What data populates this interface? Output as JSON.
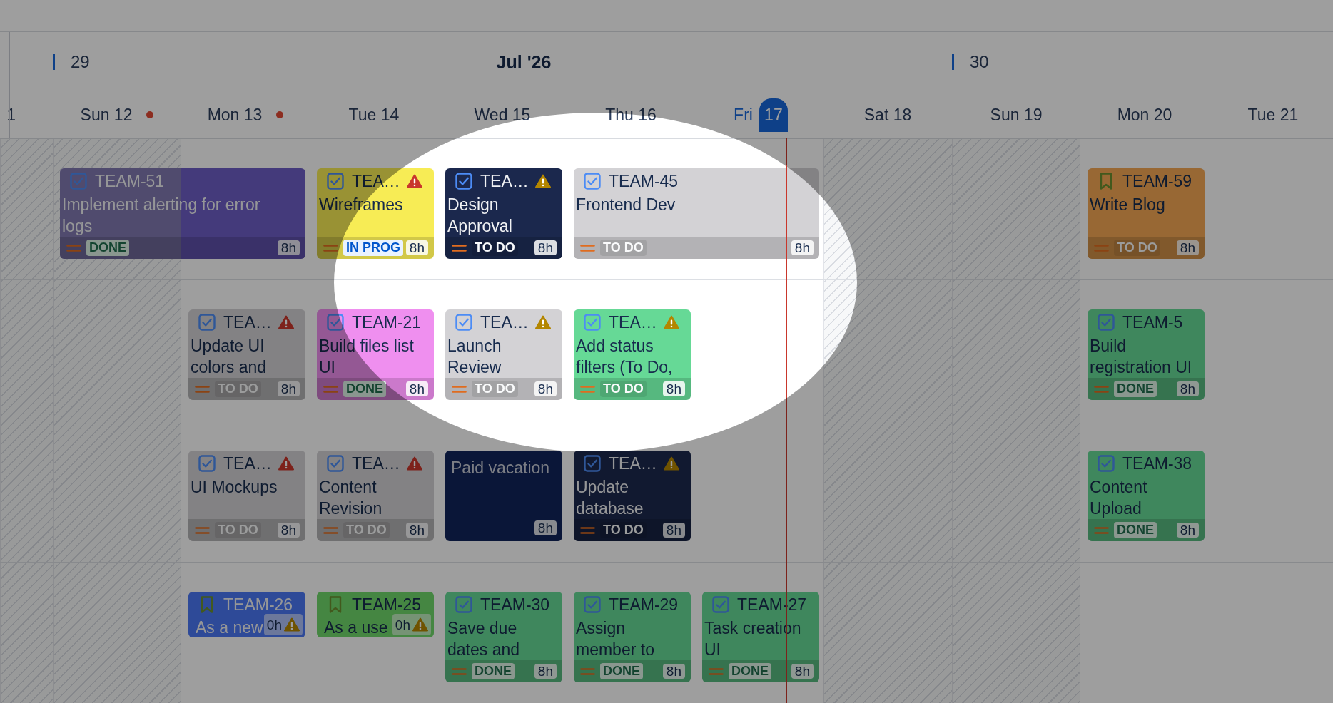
{
  "spotlight": true,
  "timeline": {
    "month": "Jul '26",
    "days": [
      {
        "date": "1",
        "weekend": true,
        "today": false,
        "has_dot": false
      },
      {
        "weekday": "Sun",
        "date": "12",
        "week": "29",
        "weekend": true,
        "today": false,
        "has_dot": true
      },
      {
        "weekday": "Mon",
        "date": "13",
        "weekend": false,
        "today": false,
        "has_dot": true
      },
      {
        "weekday": "Tue",
        "date": "14",
        "weekend": false,
        "today": false,
        "has_dot": false
      },
      {
        "weekday": "Wed",
        "date": "15",
        "weekend": false,
        "today": false,
        "has_dot": false
      },
      {
        "weekday": "Thu",
        "date": "16",
        "weekend": false,
        "today": false,
        "has_dot": false
      },
      {
        "weekday": "Fri",
        "date": "17",
        "weekend": false,
        "today": true,
        "has_dot": false
      },
      {
        "weekday": "Sat",
        "date": "18",
        "weekend": true,
        "today": false,
        "has_dot": false
      },
      {
        "weekday": "Sun",
        "date": "19",
        "week": "30",
        "weekend": true,
        "today": false,
        "has_dot": false
      },
      {
        "weekday": "Mon",
        "date": "20",
        "weekend": false,
        "today": false,
        "has_dot": false
      },
      {
        "weekday": "Tue",
        "date": "21",
        "weekend": false,
        "today": false,
        "has_dot": false
      }
    ],
    "lanes": [
      {
        "cells": [
          {
            "kind": "empty"
          },
          {
            "kind": "task",
            "key": "TEAM-51",
            "title": "Implement alerting for error logs",
            "color": "#443a7b",
            "dimmed": true,
            "wide": true,
            "status": {
              "label": "DONE",
              "kind": "done"
            },
            "estimate": "8h"
          },
          {
            "kind": "task",
            "key": "TEA…",
            "title": "Wireframes",
            "color": "#f7ec55",
            "dimmed": false,
            "wide": false,
            "warning": {
              "kind": "high"
            },
            "status": {
              "label": "IN PROG",
              "kind": "inprogress"
            },
            "estimate": "8h"
          },
          {
            "kind": "task",
            "key": "TEA…",
            "title": "Design Approval",
            "color": "#1b284d",
            "dimmed": false,
            "wide": false,
            "warning": {
              "kind": "medium"
            },
            "status": {
              "label": "TO DO",
              "kind": "todo"
            },
            "estimate": "8h"
          },
          {
            "kind": "task",
            "key": "TEAM-45",
            "title": "Frontend Dev",
            "color": "#d3d2d5",
            "dimmed": false,
            "wide": true,
            "status": {
              "label": "TO DO",
              "kind": "todo"
            },
            "estimate": "8h"
          },
          {
            "kind": "empty"
          },
          {
            "kind": "empty"
          },
          {
            "kind": "story",
            "key": "TEAM-59",
            "title": "Write Blog",
            "color": "#986834",
            "dimmed": true,
            "wide": false,
            "status": {
              "label": "TO DO",
              "kind": "todo"
            },
            "estimate": "8h"
          }
        ]
      },
      {
        "cells": [
          {
            "kind": "empty"
          },
          {
            "kind": "empty"
          },
          {
            "kind": "task",
            "key": "TEA…",
            "title": "Update UI colors and",
            "color": "#838284",
            "dimmed": true,
            "wide": false,
            "warning": {
              "kind": "high"
            },
            "status": {
              "label": "TO DO",
              "kind": "todo"
            },
            "estimate": "8h"
          },
          {
            "kind": "task",
            "key": "TEAM-21",
            "title": "Build files list UI",
            "color": "#ef8fef",
            "dimmed": false,
            "wide": false,
            "status": {
              "label": "DONE",
              "kind": "done"
            },
            "estimate": "8h"
          },
          {
            "kind": "task",
            "key": "TEA…",
            "title": "Launch Review",
            "color": "#d3d2d5",
            "dimmed": false,
            "wide": false,
            "warning": {
              "kind": "medium"
            },
            "status": {
              "label": "TO DO",
              "kind": "todo"
            },
            "estimate": "8h"
          },
          {
            "kind": "task",
            "key": "TEA…",
            "title": "Add status filters (To Do,",
            "color": "#66d996",
            "dimmed": false,
            "wide": false,
            "warning": {
              "kind": "medium"
            },
            "status": {
              "label": "TO DO",
              "kind": "todo"
            },
            "estimate": "8h"
          },
          {
            "kind": "empty"
          },
          {
            "kind": "empty"
          },
          {
            "kind": "empty"
          },
          {
            "kind": "task",
            "key": "TEAM-5",
            "title": "Build registration UI",
            "color": "#3f875d",
            "dimmed": true,
            "wide": false,
            "status": {
              "label": "DONE",
              "kind": "done"
            },
            "estimate": "8h"
          }
        ]
      },
      {
        "cells": [
          {
            "kind": "empty"
          },
          {
            "kind": "empty"
          },
          {
            "kind": "task",
            "key": "TEA…",
            "title": "UI Mockups",
            "color": "#838284",
            "dimmed": true,
            "wide": false,
            "warning": {
              "kind": "high"
            },
            "status": {
              "label": "TO DO",
              "kind": "todo"
            },
            "estimate": "8h"
          },
          {
            "kind": "task",
            "key": "TEA…",
            "title": "Content Revision",
            "color": "#838284",
            "dimmed": true,
            "wide": false,
            "warning": {
              "kind": "high"
            },
            "status": {
              "label": "TO DO",
              "kind": "todo"
            },
            "estimate": "8h"
          },
          {
            "kind": "absence",
            "title": "Paid vacation",
            "color": "#0a1638",
            "dimmed": true,
            "wide": false,
            "estimate": "8h"
          },
          {
            "kind": "task",
            "key": "TEA…",
            "title": "Update database",
            "color": "#111930",
            "dimmed": true,
            "wide": false,
            "warning": {
              "kind": "medium"
            },
            "status": {
              "label": "TO DO",
              "kind": "todo"
            },
            "estimate": "8h"
          },
          {
            "kind": "empty"
          },
          {
            "kind": "empty"
          },
          {
            "kind": "empty"
          },
          {
            "kind": "task",
            "key": "TEAM-38",
            "title": "Content Upload",
            "color": "#3f875d",
            "dimmed": true,
            "wide": false,
            "status": {
              "label": "DONE",
              "kind": "done"
            },
            "estimate": "8h"
          }
        ]
      },
      {
        "cells": [
          {
            "kind": "empty"
          },
          {
            "kind": "empty"
          },
          {
            "kind": "story",
            "key": "TEAM-26",
            "title": "As a new",
            "color": "#2e4a98",
            "dimmed": true,
            "wide": false,
            "warning": {
              "kind": "medium"
            },
            "estimate": "0h"
          },
          {
            "kind": "story",
            "key": "TEAM-25",
            "title": "As a use",
            "color": "#458642",
            "dimmed": true,
            "wide": false,
            "warning": {
              "kind": "medium"
            },
            "estimate": "0h"
          },
          {
            "kind": "task",
            "key": "TEAM-30",
            "title": "Save due dates and",
            "color": "#3f875d",
            "dimmed": true,
            "wide": false,
            "status": {
              "label": "DONE",
              "kind": "done"
            },
            "estimate": "8h"
          },
          {
            "kind": "task",
            "key": "TEAM-29",
            "title": "Assign member to",
            "color": "#3f875d",
            "dimmed": true,
            "wide": false,
            "status": {
              "label": "DONE",
              "kind": "done"
            },
            "estimate": "8h"
          },
          {
            "kind": "task",
            "key": "TEAM-27",
            "title": "Task creation UI",
            "color": "#3f875d",
            "dimmed": true,
            "wide": false,
            "status": {
              "label": "DONE",
              "kind": "done"
            },
            "estimate": "8h"
          }
        ]
      }
    ]
  }
}
